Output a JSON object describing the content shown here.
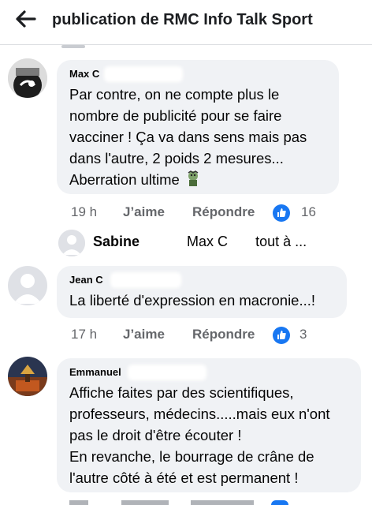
{
  "header": {
    "title": "publication de RMC Info Talk Sport"
  },
  "comments": [
    {
      "author": "Max C",
      "text": "Par contre, on ne compte plus le\nnombre de publicité pour se faire\nvacciner ! Ça va dans sens mais pas\ndans l'autre, 2 poids 2 mesures...\nAberration ultime",
      "time": "19 h",
      "like_label": "J’aime",
      "reply_label": "Répondre",
      "reactions": "16"
    },
    {
      "author": "Jean C",
      "text": "La liberté d'expression en macronie...!",
      "time": "17 h",
      "like_label": "J’aime",
      "reply_label": "Répondre",
      "reactions": "3"
    },
    {
      "author": "Emmanuel",
      "text": "Affiche faites par des scientifiques,\nprofesseurs, médecins.....mais eux n'ont\npas le droit d'être écouter !\nEn revanche, le bourrage de crâne de\nl'autre côté à été et est permanent !"
    }
  ],
  "reply_preview": {
    "name": "Sabine",
    "mention": "Max C",
    "suffix": "tout à ..."
  },
  "colors": {
    "accent": "#1877f2",
    "bubble": "#f0f2f5",
    "meta": "#65676b"
  }
}
